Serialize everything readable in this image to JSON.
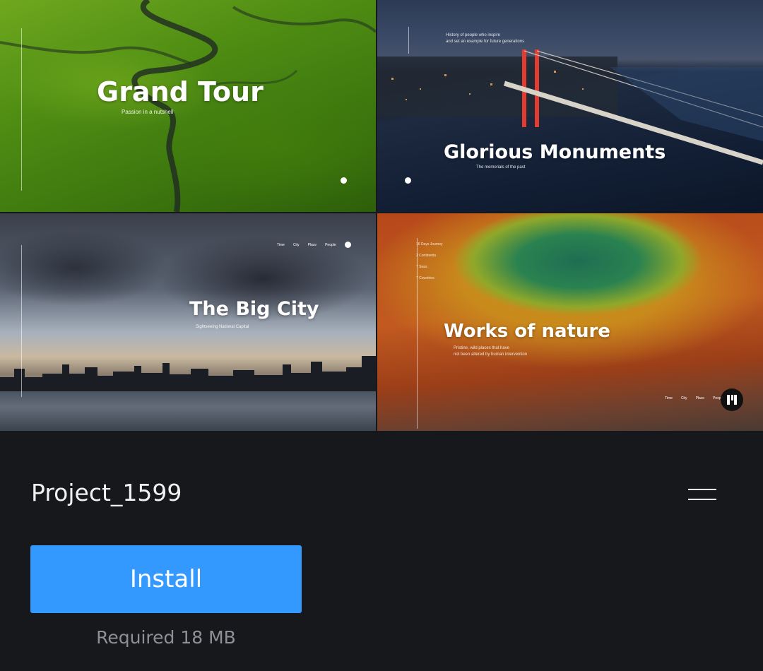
{
  "tiles": [
    {
      "title": "Grand Tour",
      "subtitle": "Passion in a nutshell"
    },
    {
      "title": "Glorious Monuments",
      "subtitle": "The memorials of the past",
      "caption": "History of people who inspire\nand set an example for future generations"
    },
    {
      "title": "The Big City",
      "subtitle": "Sightseeing National Capital",
      "nav": [
        "Time",
        "City",
        "Place",
        "People"
      ]
    },
    {
      "title": "Works of nature",
      "subtitle": "Pristine, wild places that have\nnot been altered by human intervention",
      "list": [
        "16 Days Journey",
        "3 Continents",
        "7 Seas",
        "7 Countries"
      ],
      "nav": [
        "Time",
        "City",
        "Place",
        "People"
      ]
    }
  ],
  "project": {
    "name": "Project_1599",
    "install_label": "Install",
    "required_text": "Required 18 MB"
  },
  "colors": {
    "accent": "#3399ff",
    "background": "#17181c"
  }
}
